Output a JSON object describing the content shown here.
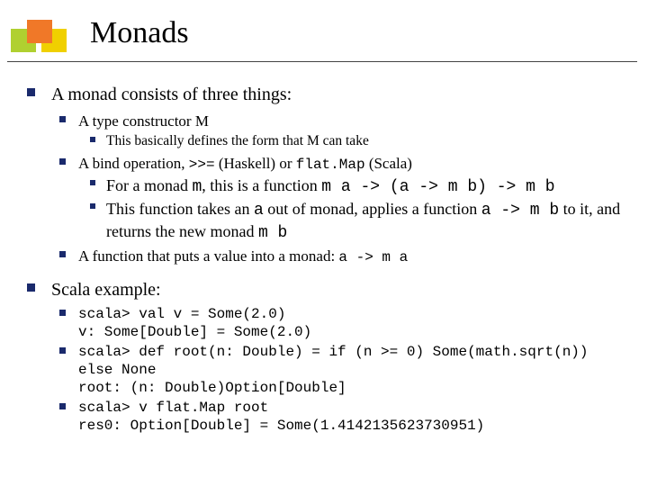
{
  "title": "Monads",
  "level1": {
    "p1": "A monad consists of three things:",
    "p2": "Scala example:"
  },
  "typeconstructor": {
    "heading": "A type constructor M",
    "sub": "This basically defines the form that M can take"
  },
  "bindop": {
    "pre": "A bind operation, ",
    "haskell_op": ">>=",
    "mid": " (Haskell) or ",
    "scala_op": "flat.Map",
    "post": " (Scala)",
    "sub1_pre": "For a monad ",
    "sub1_m": "m",
    "sub1_mid": ", this is a function   ",
    "sub1_sig": "m a -> (a -> m b) -> m b",
    "sub2_pre": "This function takes an ",
    "sub2_a": "a",
    "sub2_mid1": " out of monad, applies a function ",
    "sub2_fn": "a -> m b",
    "sub2_mid2": " to it, and returns the new monad ",
    "sub2_mb": "m b"
  },
  "putval": {
    "pre": "A function that puts a value into a monad: ",
    "sig": "a -> m a"
  },
  "scala": {
    "l1a": "scala> val v = Some(2.0)",
    "l1b": "v: Some[Double] = Some(2.0)",
    "l2a": "scala> def root(n: Double) = if (n >= 0) Some(math.sqrt(n)) else None",
    "l2b": "root: (n: Double)Option[Double]",
    "l3a": "scala> v flat.Map root",
    "l3b": "res0: Option[Double] = Some(1.4142135623730951)"
  }
}
